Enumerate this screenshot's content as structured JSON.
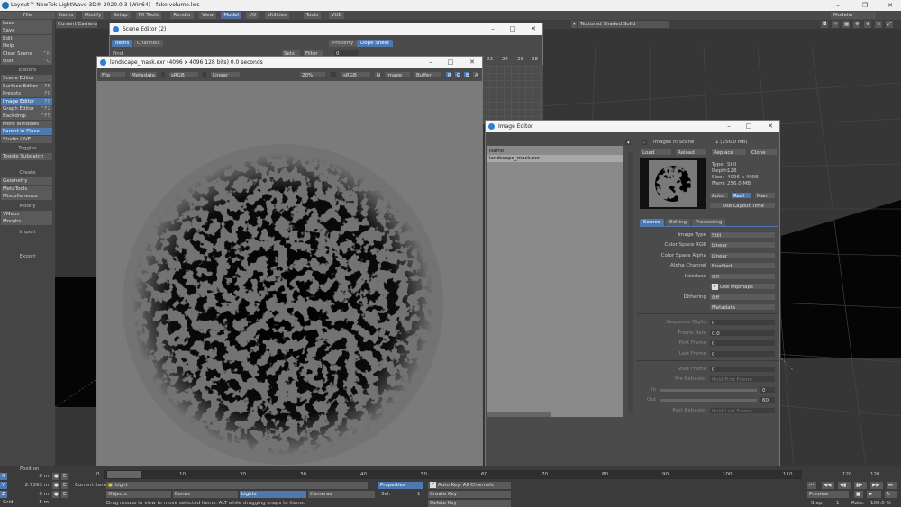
{
  "app": {
    "title": "Layout™ NewTek LightWave 3D® 2020.0.3 (Win64) - fake.volume.lws",
    "mode_dropdown": "Modeler"
  },
  "menu_tabs": [
    "Items",
    "Modify",
    "Setup",
    "FX Tools",
    "Render",
    "View",
    "Model",
    "I/O",
    "Utilities",
    "Tools",
    "VUE"
  ],
  "menu_active": "Model",
  "left_panel": {
    "file": "File",
    "file_items": [
      {
        "label": "Load",
        "key": ""
      },
      {
        "label": "Save",
        "key": ""
      },
      {
        "label": "Edit",
        "key": ""
      },
      {
        "label": "Help",
        "key": ""
      },
      {
        "label": "Clear Scene",
        "key": "^N"
      },
      {
        "label": "Quit",
        "key": "^Q"
      }
    ],
    "editors_header": "Editors",
    "editors_items": [
      {
        "label": "Scene Editor",
        "key": ""
      },
      {
        "label": "Surface Editor",
        "key": "F5"
      },
      {
        "label": "Presets",
        "key": "F8"
      },
      {
        "label": "Image Editor",
        "key": "F6"
      },
      {
        "label": "Graph Editor",
        "key": "^F2"
      },
      {
        "label": "Backdrop",
        "key": "^F5"
      },
      {
        "label": "More Windows",
        "key": ""
      },
      {
        "label": "Parent in Place",
        "key": ""
      },
      {
        "label": "Studio LIVE",
        "key": ""
      }
    ],
    "toggles_header": "Toggles",
    "toggles_items": [
      {
        "label": "Toggle Subpatch",
        "key": ""
      }
    ],
    "create_header": "Create",
    "create_items": [
      {
        "label": "Geometry",
        "key": ""
      },
      {
        "label": "MetaTools",
        "key": ""
      },
      {
        "label": "Miscellaneous",
        "key": ""
      }
    ],
    "modify_header": "Modify",
    "modify_items": [
      {
        "label": "VMaps",
        "key": ""
      },
      {
        "label": "Morphs",
        "key": ""
      }
    ],
    "import_header": "Import",
    "export_header": "Export"
  },
  "viewport": {
    "camera": "Current Camera",
    "render_mode": "Textured Shaded Solid"
  },
  "scene_editor": {
    "title": "Scene Editor (2)",
    "tabs": [
      "Items",
      "Channels"
    ],
    "right_tabs": [
      "Property",
      "Dope Sheet"
    ],
    "find_label": "Find",
    "sets_label": "Sets",
    "filter_label": "Filter",
    "frame_numbers": [
      "22",
      "24",
      "26",
      "28"
    ],
    "field_value": "0"
  },
  "image_viewer": {
    "title": "landscape_mask.exr (4096 x 4096 128 bits) 0.0 seconds",
    "toolbar": {
      "file": "File",
      "metadata": "Metadata",
      "colorspace": "sRGB",
      "space2": "Linear",
      "zoom": "20%",
      "display_space": "sRGB",
      "n_label": "N",
      "image": "Image",
      "buffer": "Buffer",
      "r": "R",
      "g": "G",
      "b": "B",
      "a": "A"
    }
  },
  "image_editor": {
    "title": "Image Editor",
    "list_header": "Name",
    "list_items": [
      "landscape_mask.exr"
    ],
    "images_in_scene_label": "Images in Scene",
    "images_in_scene_value": "1 (256.0 MB)",
    "buttons": {
      "load": "Load",
      "reload": "Reload",
      "replace": "Replace",
      "clone": "Clone"
    },
    "info": {
      "type_label": "Type:",
      "type": "Still",
      "depth_label": "Depth:",
      "depth": "128",
      "size_label": "Size:",
      "size": "4096 x 4096",
      "mem_label": "Mem:",
      "mem": "256.0 MB"
    },
    "mode_buttons": {
      "auto": "Auto",
      "real": "Real",
      "man": "Man"
    },
    "use_layout_time": "Use Layout Time",
    "tabs": [
      "Source",
      "Editing",
      "Processing"
    ],
    "props": [
      {
        "label": "Image Type",
        "value": "Still"
      },
      {
        "label": "Color Space RGB",
        "value": "Linear"
      },
      {
        "label": "Color Space Alpha",
        "value": "Linear"
      },
      {
        "label": "Alpha Channel",
        "value": "Enabled"
      },
      {
        "label": "Interlace",
        "value": "Off"
      }
    ],
    "use_mipmaps": "Use Mipmaps",
    "dithering_label": "Dithering",
    "dithering_value": "Off",
    "metadata_button": "Metadata",
    "seq": [
      {
        "label": "Sequence Digits",
        "value": "0"
      },
      {
        "label": "Frame Rate",
        "value": "0.0"
      },
      {
        "label": "First Frame",
        "value": "0"
      },
      {
        "label": "Last Frame",
        "value": "0"
      }
    ],
    "start_frame_label": "Start Frame",
    "start_frame_value": "0",
    "pre_behavior_label": "Pre Behavior",
    "pre_behavior_value": "Hold First Frame",
    "in_label": "In",
    "in_value": "0",
    "out_label": "Out",
    "out_value": "60",
    "post_behavior_label": "Post Behavior",
    "post_behavior_value": "Hold Last Frame"
  },
  "bottom": {
    "position_label": "Position",
    "x_label": "X",
    "x_value": "0 m",
    "y_label": "Y",
    "y_value": "2.7393 m",
    "z_label": "Z",
    "z_value": "0 m",
    "grid_label": "Grid:",
    "grid_value": "5 m",
    "e_label": "E",
    "timeline_ticks": [
      "0",
      "10",
      "20",
      "30",
      "40",
      "50",
      "60",
      "70",
      "80",
      "90",
      "100",
      "110",
      "120"
    ],
    "timeline_start": "0",
    "timeline_end": "120",
    "timeline_end2": "120",
    "current_item_label": "Current Item",
    "current_item_value": "Light",
    "objects": "Objects",
    "bones": "Bones",
    "lights": "Lights",
    "cameras": "Cameras",
    "properties": "Properties",
    "sel_label": "Sel:",
    "sel_value": "1",
    "auto_key": "Auto Key: All Channels",
    "create_key": "Create Key",
    "delete_key": "Delete Key",
    "status": "Drag mouse in view to move selected items. ALT while dragging snaps to items.",
    "preview": "Preview",
    "step_label": "Step",
    "step_value": "1",
    "rate_label": "Rate:",
    "rate_value": "100.0 %"
  },
  "colors": {
    "accent": "#4e78b0",
    "window_bg": "#4b4b4b",
    "titlebar": "#f4f4f4"
  }
}
